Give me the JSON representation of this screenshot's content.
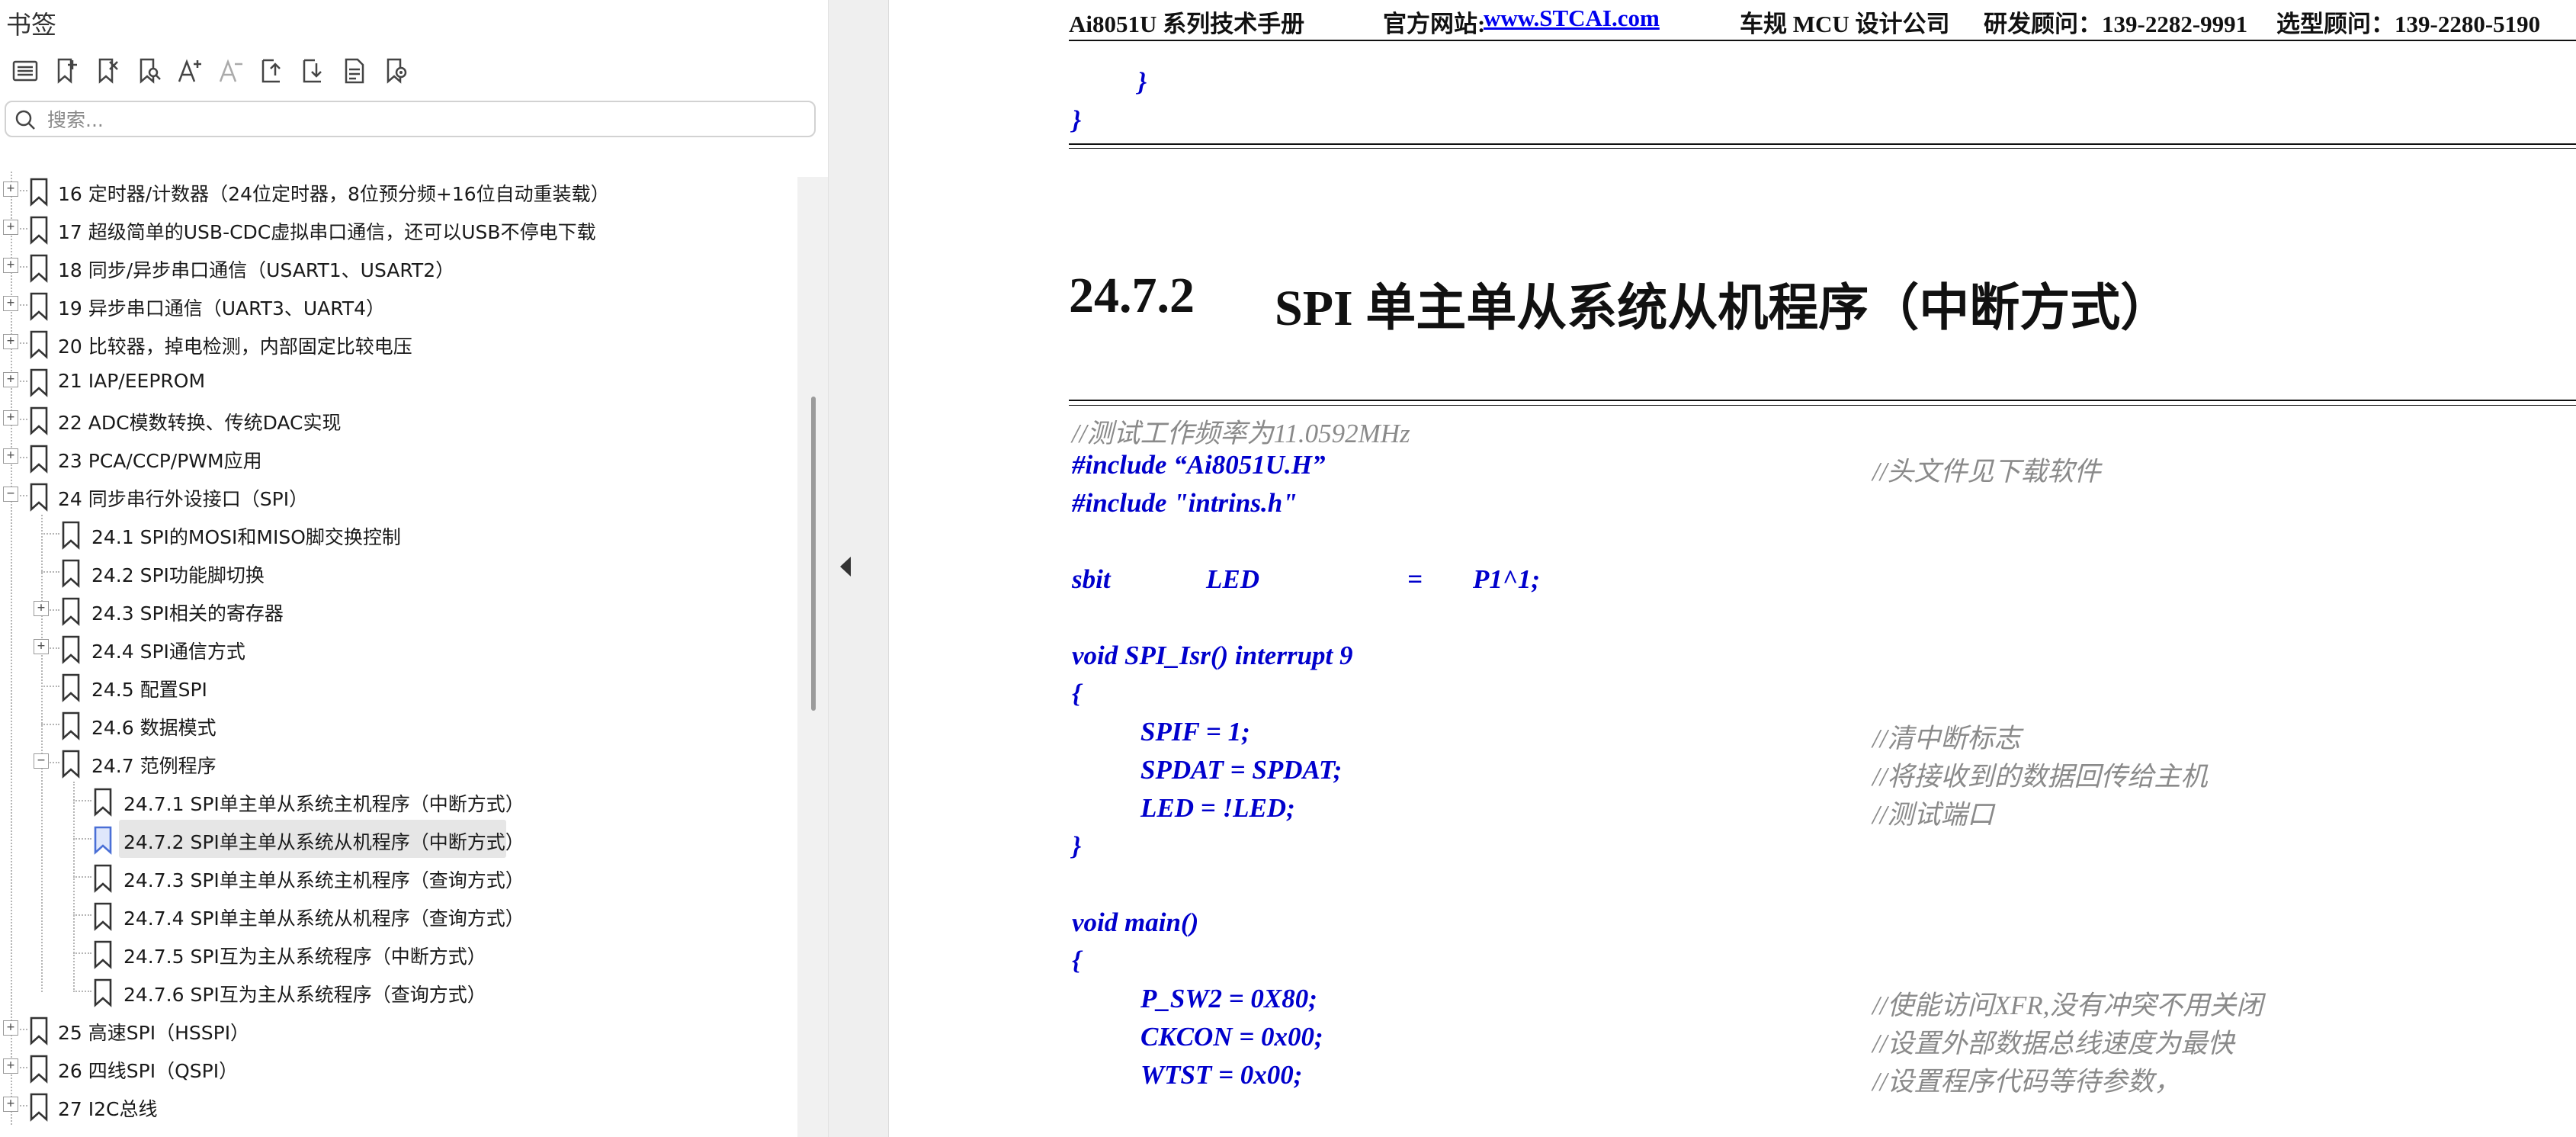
{
  "sidebar": {
    "title": "书签",
    "toolbar": [
      {
        "name": "bookmark-list-icon",
        "tip": ""
      },
      {
        "name": "add-bookmark-icon",
        "tip": ""
      },
      {
        "name": "delete-bookmark-icon",
        "tip": ""
      },
      {
        "name": "find-bookmark-icon",
        "tip": ""
      },
      {
        "name": "enlarge-font-icon",
        "tip": ""
      },
      {
        "name": "shrink-font-icon",
        "tip": ""
      },
      {
        "name": "expand-all-icon",
        "tip": ""
      },
      {
        "name": "collapse-all-icon",
        "tip": ""
      },
      {
        "name": "bookmark-page-icon",
        "tip": ""
      },
      {
        "name": "bookmark-settings-icon",
        "tip": ""
      }
    ],
    "search": {
      "placeholder": "搜索..."
    },
    "tree": [
      {
        "label": "16  定时器/计数器（24位定时器，8位预分频+16位自动重装载）",
        "level": 0,
        "expander": "+"
      },
      {
        "label": "17  超级简单的USB-CDC虚拟串口通信，还可以USB不停电下载",
        "level": 0,
        "expander": "+"
      },
      {
        "label": "18  同步/异步串口通信（USART1、USART2）",
        "level": 0,
        "expander": "+"
      },
      {
        "label": "19  异步串口通信（UART3、UART4）",
        "level": 0,
        "expander": "+"
      },
      {
        "label": "20  比较器，掉电检测，内部固定比较电压",
        "level": 0,
        "expander": "+"
      },
      {
        "label": "21  IAP/EEPROM",
        "level": 0,
        "expander": "+"
      },
      {
        "label": "22  ADC模数转换、传统DAC实现",
        "level": 0,
        "expander": "+"
      },
      {
        "label": "23  PCA/CCP/PWM应用",
        "level": 0,
        "expander": "+"
      },
      {
        "label": "24  同步串行外设接口（SPI）",
        "level": 0,
        "expander": "−"
      },
      {
        "label": "24.1 SPI的MOSI和MISO脚交换控制",
        "level": 1,
        "expander": ""
      },
      {
        "label": "24.2 SPI功能脚切换",
        "level": 1,
        "expander": ""
      },
      {
        "label": "24.3  SPI相关的寄存器",
        "level": 1,
        "expander": "+"
      },
      {
        "label": "24.4  SPI通信方式",
        "level": 1,
        "expander": "+"
      },
      {
        "label": "24.5  配置SPI",
        "level": 1,
        "expander": ""
      },
      {
        "label": "24.6  数据模式",
        "level": 1,
        "expander": ""
      },
      {
        "label": "24.7 范例程序",
        "level": 1,
        "expander": "−"
      },
      {
        "label": "24.7.1 SPI单主单从系统主机程序（中断方式）",
        "level": 2,
        "expander": ""
      },
      {
        "label": "24.7.2 SPI单主单从系统从机程序（中断方式）",
        "level": 2,
        "expander": "",
        "selected": true
      },
      {
        "label": "24.7.3 SPI单主单从系统主机程序（查询方式）",
        "level": 2,
        "expander": ""
      },
      {
        "label": "24.7.4 SPI单主单从系统从机程序（查询方式）",
        "level": 2,
        "expander": ""
      },
      {
        "label": "24.7.5 SPI互为主从系统程序（中断方式）",
        "level": 2,
        "expander": ""
      },
      {
        "label": "24.7.6 SPI互为主从系统程序（查询方式）",
        "level": 2,
        "expander": ""
      },
      {
        "label": "25  高速SPI（HSSPI）",
        "level": 0,
        "expander": "+"
      },
      {
        "label": "26  四线SPI（QSPI）",
        "level": 0,
        "expander": "+"
      },
      {
        "label": "27  I2C总线",
        "level": 0,
        "expander": "+"
      }
    ]
  },
  "document": {
    "header": {
      "product": "Ai8051U 系列技术手册",
      "website_label": "官方网站:",
      "website_link": "www.STCAI.com",
      "category": "车规 MCU 设计公司",
      "dev_contact": "研发顾问：139-2282-9991",
      "sel_contact": "选型顾问：139-2280-5190"
    },
    "prev_code": [
      "}",
      "}"
    ],
    "section_number": "24.7.2",
    "section_title": "SPI 单主单从系统从机程序（中断方式）",
    "code_lines": [
      {
        "code": "",
        "comment": "//测试工作频率为11.0592MHz",
        "indent": 0,
        "comment_only": true
      },
      {
        "code": "#include “Ai8051U.H”",
        "comment": "//头文件见下载软件",
        "indent": 0
      },
      {
        "code": "#include \"intrins.h\"",
        "comment": "",
        "indent": 0
      },
      {
        "code": "",
        "comment": "",
        "indent": 0
      },
      {
        "code": "sbit",
        "code2": "LED",
        "code3": "=",
        "code4": "P1^1;",
        "comment": "",
        "indent": 0,
        "sbit": true
      },
      {
        "code": "",
        "comment": "",
        "indent": 0
      },
      {
        "code": "void SPI_Isr() interrupt 9",
        "comment": "",
        "indent": 0
      },
      {
        "code": "{",
        "comment": "",
        "indent": 0
      },
      {
        "code": "SPIF = 1;",
        "comment": "//清中断标志",
        "indent": 1
      },
      {
        "code": "SPDAT = SPDAT;",
        "comment": "//将接收到的数据回传给主机",
        "indent": 1
      },
      {
        "code": "LED = !LED;",
        "comment": "//测试端口",
        "indent": 1
      },
      {
        "code": "}",
        "comment": "",
        "indent": 0
      },
      {
        "code": "",
        "comment": "",
        "indent": 0
      },
      {
        "code": "void main()",
        "comment": "",
        "indent": 0
      },
      {
        "code": "{",
        "comment": "",
        "indent": 0
      },
      {
        "code": "P_SW2 = 0X80;",
        "comment": "//使能访问XFR,没有冲突不用关闭",
        "indent": 1
      },
      {
        "code": "CKCON = 0x00;",
        "comment": "//设置外部数据总线速度为最快",
        "indent": 1
      },
      {
        "code": "WTST = 0x00;",
        "comment": "//设置程序代码等待参数，",
        "indent": 1
      }
    ]
  },
  "colors": {
    "code": "#0000cc",
    "comment": "#8a8a8a",
    "link": "#0000ee",
    "selection": "#e6e6e6",
    "selected_icon": "#4a6fd6"
  }
}
